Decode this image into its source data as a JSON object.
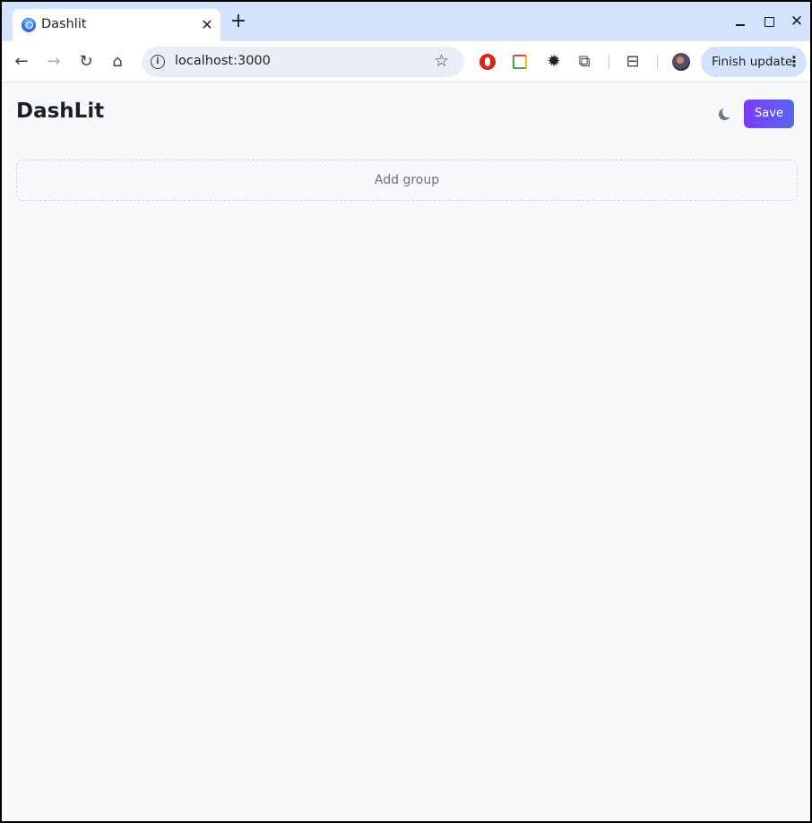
{
  "browser": {
    "tab": {
      "title": "Dashlit",
      "favicon": "dashlit-favicon-icon",
      "close_glyph": "✕"
    },
    "new_tab_glyph": "+",
    "window_controls": {
      "close_glyph": "✕"
    },
    "toolbar": {
      "back_glyph": "←",
      "forward_glyph": "→",
      "reload_glyph": "↻",
      "home_glyph": "⌂",
      "url": "localhost:3000",
      "info_glyph": "i",
      "star_glyph": "☆",
      "ext_sun_glyph": "✹",
      "puzzle_glyph": "⧉",
      "media_glyph": "⊟",
      "finish_update_label": "Finish update",
      "menu_glyph": "⋮"
    }
  },
  "app": {
    "brand": "DashLit",
    "save_label": "Save",
    "add_group_label": "Add group",
    "accent_gradient": [
      "#7a3cf5",
      "#5866f8"
    ]
  }
}
